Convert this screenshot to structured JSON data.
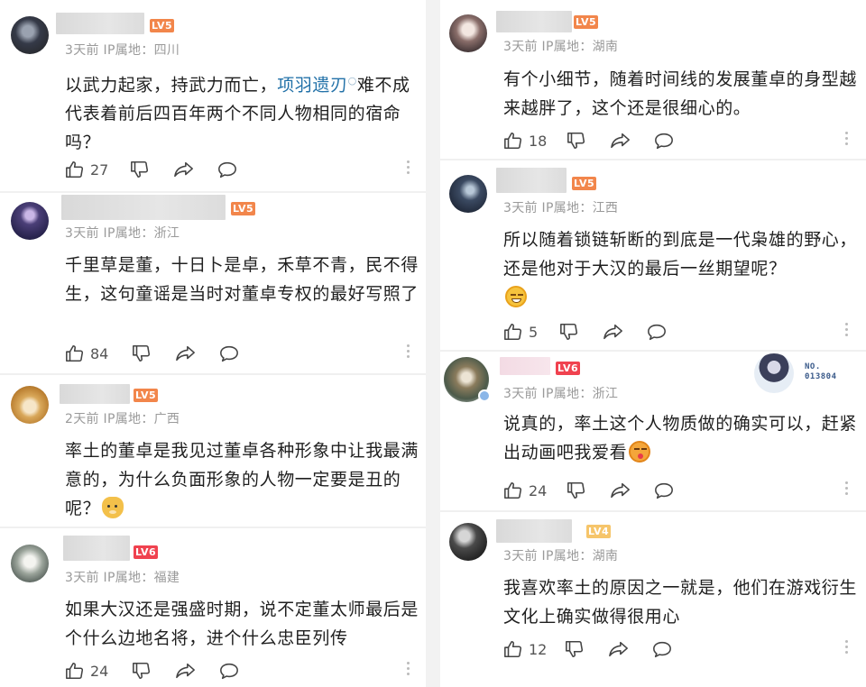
{
  "actions": {
    "like_icon": "thumbs-up-icon",
    "dislike_icon": "thumbs-down-icon",
    "share_icon": "share-icon",
    "reply_icon": "comment-icon",
    "more_icon": "more-vertical-icon"
  },
  "colors": {
    "lv5": "#f2864b",
    "lv6": "#f0424f",
    "lv4": "#f6c56a",
    "link": "#2271a8",
    "meta_text": "#9a9a9a"
  },
  "left_column": [
    {
      "level": "LV5",
      "meta": "3天前  IP属地：四川",
      "text_before": "以武力起家，持武力而亡，",
      "link": "项羽遗刃",
      "text_after": "难不成代表着前后四百年两个不同人物相同的宿命吗？",
      "likes": "27"
    },
    {
      "level": "LV5",
      "meta": "3天前  IP属地：浙江",
      "text": "千里草是董，十日卜是卓，禾草不青，民不得生，这句童谣是当时对董卓专权的最好写照了",
      "likes": "84"
    },
    {
      "level": "LV5",
      "meta": "2天前  IP属地：广西",
      "text": "率土的董卓是我见过董卓各种形象中让我最满意的，为什么负面形象的人物一定要是丑的呢？",
      "emoji": "doge-emoji",
      "likes": ""
    },
    {
      "level": "LV6",
      "meta": "3天前  IP属地：福建",
      "text": "如果大汉还是强盛时期，说不定董太师最后是个什么边地名将，进个什么忠臣列传",
      "likes": "24"
    }
  ],
  "right_column": [
    {
      "level": "LV5",
      "meta": "3天前  IP属地：湖南",
      "text": "有个小细节，随着时间线的发展董卓的身型越来越胖了，这个还是很细心的。",
      "likes": "18"
    },
    {
      "level": "LV5",
      "meta": "3天前  IP属地：江西",
      "text": "所以随着锁链斩断的到底是一代枭雄的野心，还是他对于大汉的最后一丝期望呢？",
      "emoji": "smile-emoji",
      "likes": "5"
    },
    {
      "level": "LV6",
      "meta": "3天前  IP属地：浙江",
      "text": "说真的，率土这个人物质做的确实可以，赶紧出动画吧我爱看",
      "emoji": "kiss-emoji",
      "badge_no": "NO.\n013804",
      "likes": "24"
    },
    {
      "level": "LV4",
      "meta": "3天前  IP属地：湖南",
      "text": "我喜欢率土的原因之一就是，他们在游戏衍生文化上确实做得很用心",
      "likes": "12"
    }
  ]
}
